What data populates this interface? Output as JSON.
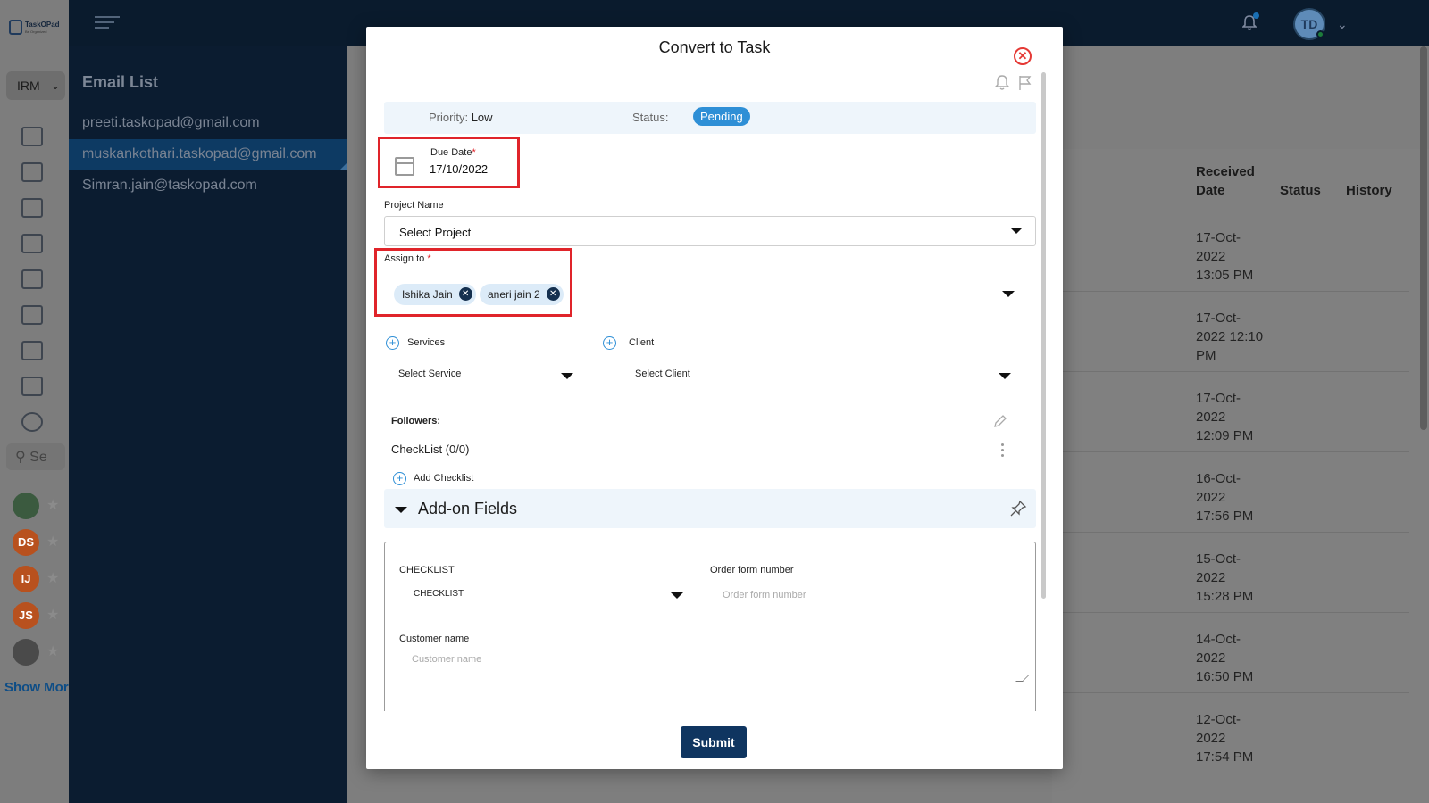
{
  "app": {
    "logo_text": "TaskOPad",
    "logo_sub": "Be Organized",
    "workspace": "IRM",
    "search_placeholder": "Se",
    "show_more": "Show Mor",
    "user_initials": "TD",
    "avatars": [
      {
        "initials": "",
        "color": "#3b5a3f"
      },
      {
        "initials": "DS",
        "color": "#b8511e"
      },
      {
        "initials": "IJ",
        "color": "#b8511e"
      },
      {
        "initials": "JS",
        "color": "#b8511e"
      },
      {
        "initials": "",
        "color": "#4a4a4a"
      }
    ]
  },
  "email_panel": {
    "title": "Email List",
    "emails": [
      "preeti.taskopad@gmail.com",
      "muskankothari.taskopad@gmail.com",
      "Simran.jain@taskopad.com"
    ],
    "active_index": 1
  },
  "table": {
    "headers": {
      "received": "Received Date",
      "status": "Status",
      "history": "History"
    },
    "dates": [
      [
        "17-Oct-",
        "2022",
        "13:05 PM"
      ],
      [
        "17-Oct-",
        "2022 12:10",
        "PM"
      ],
      [
        "17-Oct-",
        "2022",
        "12:09 PM"
      ],
      [
        "16-Oct-",
        "2022",
        "17:56 PM"
      ],
      [
        "15-Oct-",
        "2022",
        "15:28 PM"
      ],
      [
        "14-Oct-",
        "2022",
        "16:50 PM"
      ],
      [
        "12-Oct-",
        "2022",
        "17:54 PM"
      ]
    ]
  },
  "modal": {
    "title": "Convert to Task",
    "priority_label": "Priority:",
    "priority_value": "Low",
    "status_label": "Status:",
    "status_value": "Pending",
    "due_date_label": "Due Date",
    "due_date_value": "17/10/2022",
    "project_label": "Project Name",
    "project_value": "Select Project",
    "assign_label": "Assign to",
    "assignees": [
      "Ishika Jain",
      "aneri jain 2"
    ],
    "services_label": "Services",
    "services_value": "Select Service",
    "client_label": "Client",
    "client_value": "Select Client",
    "followers_label": "Followers:",
    "checklist_label": "CheckList (0/0)",
    "add_checklist": "Add Checklist",
    "addon_title": "Add-on Fields",
    "checklist_field_label": "CHECKLIST",
    "checklist_field_value": "CHECKLIST",
    "order_label": "Order form number",
    "order_placeholder": "Order form number",
    "customer_label": "Customer name",
    "customer_placeholder": "Customer name",
    "submit": "Submit",
    "accent": "#2e8fd6",
    "highlight": "#e0242a"
  }
}
